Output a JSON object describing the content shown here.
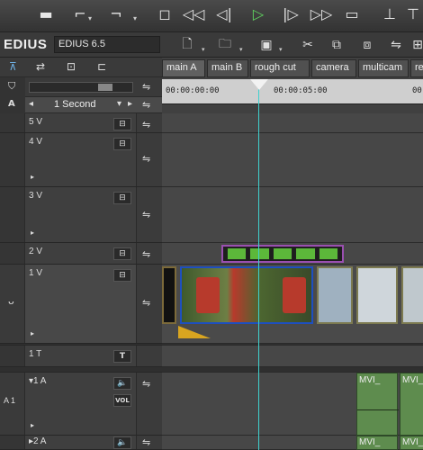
{
  "app": {
    "logo": "EDIUS",
    "project": "EDIUS 6.5"
  },
  "timeline": {
    "tabs": [
      "main A",
      "main B",
      "rough cut",
      "camera",
      "multicam",
      "re"
    ],
    "active_tab": 0,
    "zoom_label": "1 Second",
    "timecodes": [
      "00:00:00:00",
      "00:00:05:00",
      "00"
    ],
    "tracks": [
      {
        "name": "5 V"
      },
      {
        "name": "4 V"
      },
      {
        "name": "3 V"
      },
      {
        "name": "2 V"
      },
      {
        "name": "1 V"
      },
      {
        "name": "1 T"
      },
      {
        "name": "▾1 A"
      },
      {
        "name": "▸2 A"
      }
    ],
    "audio_clip_label": "MVI_",
    "vol_label": "VOL",
    "track_label_A1": "A 1"
  },
  "colors": {
    "cursor": "#3fd1cf",
    "playhead": "#f2f2f2",
    "selected_clip": "#1e4fbf"
  }
}
